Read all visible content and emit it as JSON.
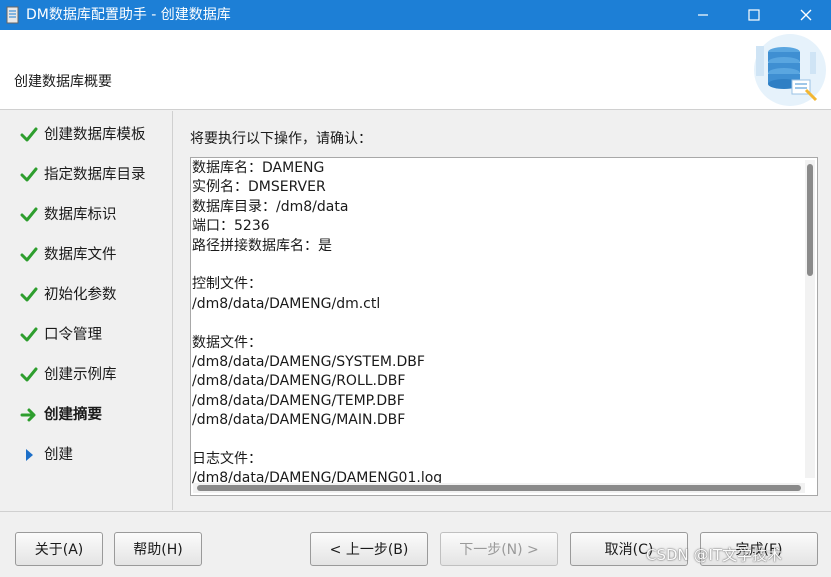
{
  "window": {
    "title": "DM数据库配置助手 - 创建数据库",
    "title_color": "#1d7fd6"
  },
  "header": {
    "title": "创建数据库概要"
  },
  "steps": [
    {
      "label": "创建数据库模板",
      "status": "done",
      "icon": "checkmark-icon"
    },
    {
      "label": "指定数据库目录",
      "status": "done",
      "icon": "checkmark-icon"
    },
    {
      "label": "数据库标识",
      "status": "done",
      "icon": "checkmark-icon"
    },
    {
      "label": "数据库文件",
      "status": "done",
      "icon": "checkmark-icon"
    },
    {
      "label": "初始化参数",
      "status": "done",
      "icon": "checkmark-icon"
    },
    {
      "label": "口令管理",
      "status": "done",
      "icon": "checkmark-icon"
    },
    {
      "label": "创建示例库",
      "status": "done",
      "icon": "checkmark-icon"
    },
    {
      "label": "创建摘要",
      "status": "current",
      "icon": "arrow-right-icon"
    },
    {
      "label": "创建",
      "status": "pending",
      "icon": "triangle-right-icon"
    }
  ],
  "main": {
    "prompt": "将要执行以下操作，请确认：",
    "summary_lines": [
      "数据库名：DAMENG",
      "实例名：DMSERVER",
      "数据库目录：/dm8/data",
      "端口：5236",
      "路径拼接数据库名：是",
      "",
      "控制文件：",
      "/dm8/data/DAMENG/dm.ctl",
      "",
      "数据文件：",
      "/dm8/data/DAMENG/SYSTEM.DBF",
      "/dm8/data/DAMENG/ROLL.DBF",
      "/dm8/data/DAMENG/TEMP.DBF",
      "/dm8/data/DAMENG/MAIN.DBF",
      "",
      "日志文件：",
      "/dm8/data/DAMENG/DAMENG01.log"
    ]
  },
  "footer": {
    "about": "关于(A)",
    "help": "帮助(H)",
    "prev": "< 上一步(B)",
    "next": "下一步(N) >",
    "cancel": "取消(C)",
    "finish": "完成(F)"
  },
  "watermark": "CSDN @IT文学技术",
  "colors": {
    "check": "#2e9e2e",
    "arrow": "#2e9e2e",
    "pending": "#1d6fc8"
  }
}
